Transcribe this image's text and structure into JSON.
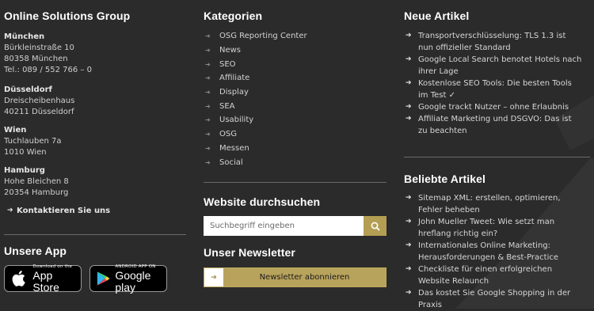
{
  "company": {
    "heading": "Online Solutions Group",
    "offices": [
      {
        "city": "München",
        "lines": [
          "Bürkleinstraße 10",
          "80358 München",
          "Tel.: 089 / 552 766 – 0"
        ]
      },
      {
        "city": "Düsseldorf",
        "lines": [
          "Dreischeibenhaus",
          "40211 Düsseldorf"
        ]
      },
      {
        "city": "Wien",
        "lines": [
          "Tuchlauben 7a",
          "1010 Wien"
        ]
      },
      {
        "city": "Hamburg",
        "lines": [
          "Hohe Bleichen 8",
          "20354 Hamburg"
        ]
      }
    ],
    "contact_label": "Kontaktieren Sie uns"
  },
  "app": {
    "heading": "Unsere App",
    "appstore": {
      "small": "Download on the",
      "big": "App Store"
    },
    "googleplay": {
      "small": "ANDROID APP ON",
      "big": "Google play"
    }
  },
  "categories": {
    "heading": "Kategorien",
    "items": [
      "OSG Reporting Center",
      "News",
      "SEO",
      "Affiliate",
      "Display",
      "SEA",
      "Usability",
      "OSG",
      "Messen",
      "Social"
    ]
  },
  "search": {
    "heading": "Website durchsuchen",
    "placeholder": "Suchbegriff eingeben"
  },
  "newsletter": {
    "heading": "Unser Newsletter",
    "button_label": "Newsletter abonnieren"
  },
  "new_articles": {
    "heading": "Neue Artikel",
    "items": [
      "Transportverschlüsselung: TLS 1.3 ist nun offizieller Standard",
      "Google Local Search benotet Hotels nach ihrer Lage",
      "Kostenlose SEO Tools: Die besten Tools im Test ✓",
      "Google trackt Nutzer – ohne Erlaubnis",
      "Affiliate Marketing und DSGVO: Das ist zu beachten"
    ]
  },
  "popular_articles": {
    "heading": "Beliebte Artikel",
    "items": [
      "Sitemap XML: erstellen, optimieren, Fehler beheben",
      "John Mueller Tweet: Wie setzt man hreflang richtig ein?",
      "Internationales Online Marketing: Herausforderungen & Best-Practice",
      "Checkliste für einen erfolgreichen Website Relaunch",
      "Das kostet Sie Google Shopping in der Praxis"
    ]
  },
  "colors": {
    "background": "#2b2b2b",
    "accent": "#b8a35c",
    "text": "#d8d8d8"
  }
}
